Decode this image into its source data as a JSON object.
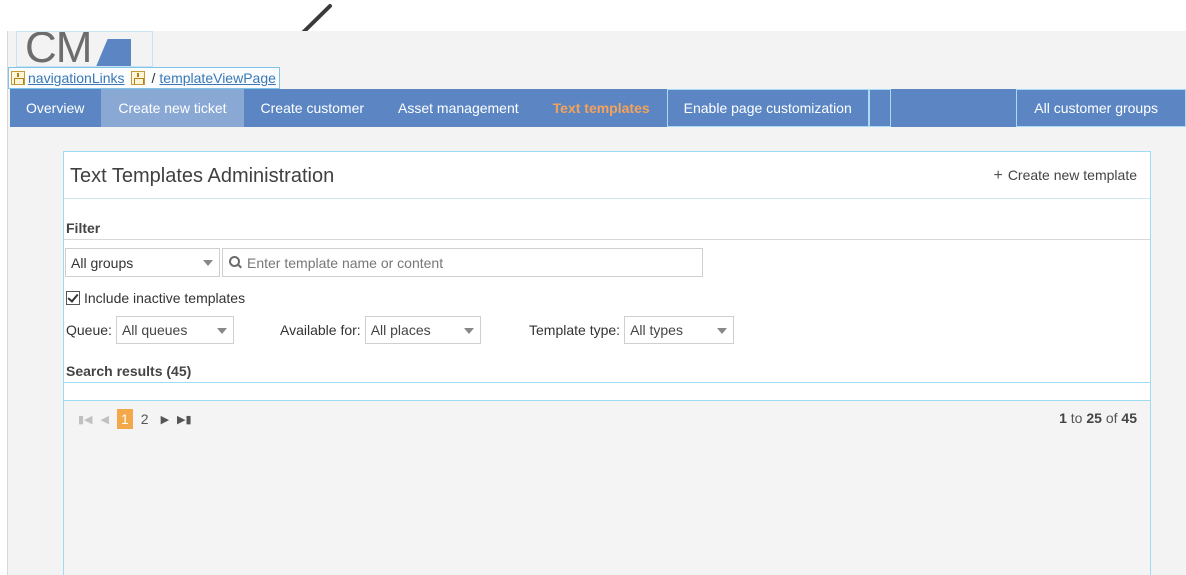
{
  "debug_breadcrumb": {
    "link1": "navigationLinks",
    "separator": "/",
    "link2": "templateViewPage"
  },
  "logo": {
    "text": "CM"
  },
  "nav": {
    "items": [
      {
        "label": "Overview"
      },
      {
        "label": "Create new ticket"
      },
      {
        "label": "Create customer"
      },
      {
        "label": "Asset management"
      },
      {
        "label": "Text templates"
      },
      {
        "label": "Enable page customization"
      }
    ],
    "groups_label": "All customer groups",
    "active_color": "#f5a25a",
    "bar_color": "#5b86c3"
  },
  "panel": {
    "title": "Text Templates Administration",
    "create_label": "Create new template"
  },
  "filter": {
    "label": "Filter",
    "group_value": "All groups",
    "search_placeholder": "Enter template name or content",
    "inactive_label": "Include inactive templates",
    "queue_label": "Queue:",
    "queue_value": "All queues",
    "available_label": "Available for:",
    "available_value": "All places",
    "type_label": "Template type:",
    "type_value": "All types"
  },
  "results": {
    "label": "Search results (45)"
  },
  "pager": {
    "pages": [
      "1",
      "2"
    ],
    "current_page": "1",
    "range_start": "1",
    "range_to": " to ",
    "range_end": "25",
    "range_of": " of ",
    "total": "45"
  }
}
